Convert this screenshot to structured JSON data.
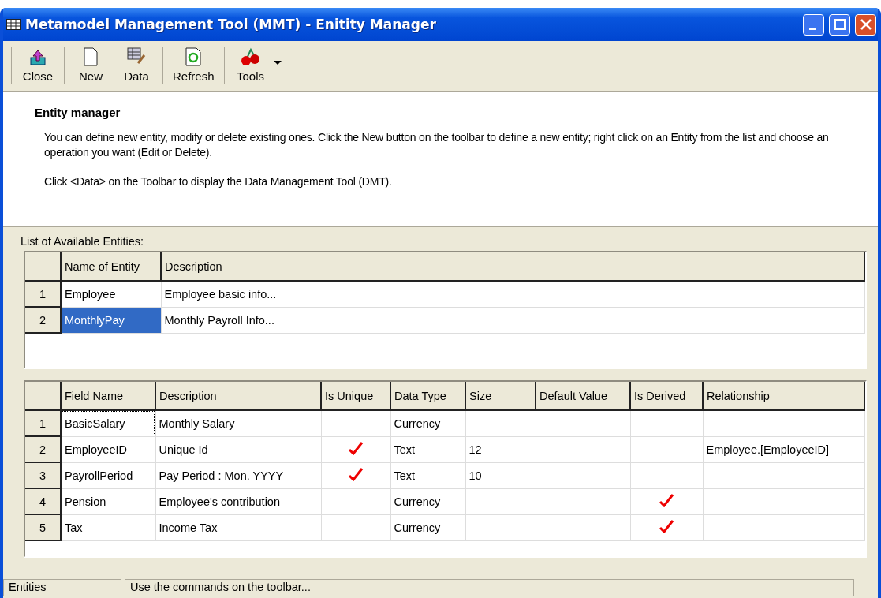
{
  "window": {
    "title": "Metamodel Management Tool (MMT) - Enitity Manager"
  },
  "toolbar": {
    "buttons": [
      {
        "label": "Close",
        "kind": "close"
      },
      {
        "label": "New",
        "kind": "new"
      },
      {
        "label": "Data",
        "kind": "data"
      },
      {
        "label": "Refresh",
        "kind": "refresh"
      },
      {
        "label": "Tools",
        "kind": "tools"
      }
    ]
  },
  "info": {
    "heading": "Entity manager",
    "paragraphs": [
      "You can define new entity, modify or delete existing ones. Click the New button on the toolbar to define a new entity; right click on an Entity from the list and choose an operation you want (Edit or Delete).",
      "Click <Data> on the Toolbar to display the Data Management Tool (DMT)."
    ]
  },
  "entities": {
    "label": "List of Available Entities:",
    "columns": [
      "Name of Entity",
      "Description"
    ],
    "rows": [
      {
        "number": "1",
        "name": "Employee",
        "description": "Employee basic info...",
        "selected": false
      },
      {
        "number": "2",
        "name": "MonthlyPay",
        "description": "Monthly Payroll Info...",
        "selected": true
      }
    ]
  },
  "fields": {
    "columns": [
      "Field Name",
      "Description",
      "Is Unique",
      "Data Type",
      "Size",
      "Default Value",
      "Is Derived",
      "Relationship"
    ],
    "rows": [
      {
        "number": "1",
        "name": "BasicSalary",
        "description": "Monthly Salary",
        "is_unique": false,
        "data_type": "Currency",
        "size": "",
        "is_derived": false,
        "relationship": "",
        "focused": true
      },
      {
        "number": "2",
        "name": "EmployeeID",
        "description": "Unique Id",
        "is_unique": true,
        "data_type": "Text",
        "size": "12",
        "is_derived": false,
        "relationship": "Employee.[EmployeeID]",
        "focused": false
      },
      {
        "number": "3",
        "name": "PayrollPeriod",
        "description": "Pay Period : Mon. YYYY",
        "is_unique": true,
        "data_type": "Text",
        "size": "10",
        "is_derived": false,
        "relationship": "",
        "focused": false
      },
      {
        "number": "4",
        "name": "Pension",
        "description": "Employee's contribution",
        "is_unique": false,
        "data_type": "Currency",
        "size": "",
        "is_derived": true,
        "relationship": "",
        "focused": false
      },
      {
        "number": "5",
        "name": "Tax",
        "description": "Income Tax",
        "is_unique": false,
        "data_type": "Currency",
        "size": "",
        "is_derived": true,
        "relationship": "",
        "focused": false
      }
    ]
  },
  "status_bar": {
    "panels": [
      "Entities",
      "Use the commands on the toolbar..."
    ]
  }
}
